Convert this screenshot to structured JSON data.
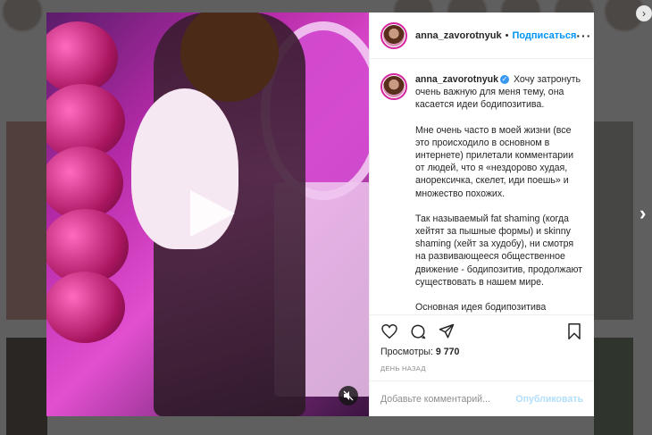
{
  "post": {
    "username": "anna_zavorotnyuk",
    "follow_label": "Подписаться",
    "separator": "•",
    "caption_paragraphs": [
      "Хочу затронуть очень важную для меня тему, она касается идеи бодипозитива.",
      "Мне очень часто в моей жизни (все это происходило в основном в интернете) прилетали комментарии от людей, что я «нездорово худая, анорексичка, скелет, иди поешь» и множество похожих.",
      "Так называемый fat shaming (когда хейтят за пышные формы) и skinny shaming (хейт за худобу), ни смотря на развивающееся общественное движение - бодипозитив, продолжают существовать в нашем мире.",
      "Основная идея бодипозитива"
    ],
    "views_label": "Просмотры:",
    "views_count": "9 770",
    "time_label": "ДЕНЬ НАЗАД",
    "comment_placeholder": "Добавьте комментарий...",
    "publish_label": "Опубликовать"
  },
  "icons": {
    "more": "more-options-icon",
    "like": "heart-icon",
    "comment": "comment-icon",
    "share": "share-icon",
    "save": "bookmark-icon",
    "play": "play-icon",
    "mute": "muted-speaker-icon",
    "verified": "verified-badge-icon",
    "next": "chevron-right-icon"
  },
  "colors": {
    "accent": "#0095f6",
    "verified": "#3897f0",
    "publish_disabled": "#b2dffc"
  }
}
